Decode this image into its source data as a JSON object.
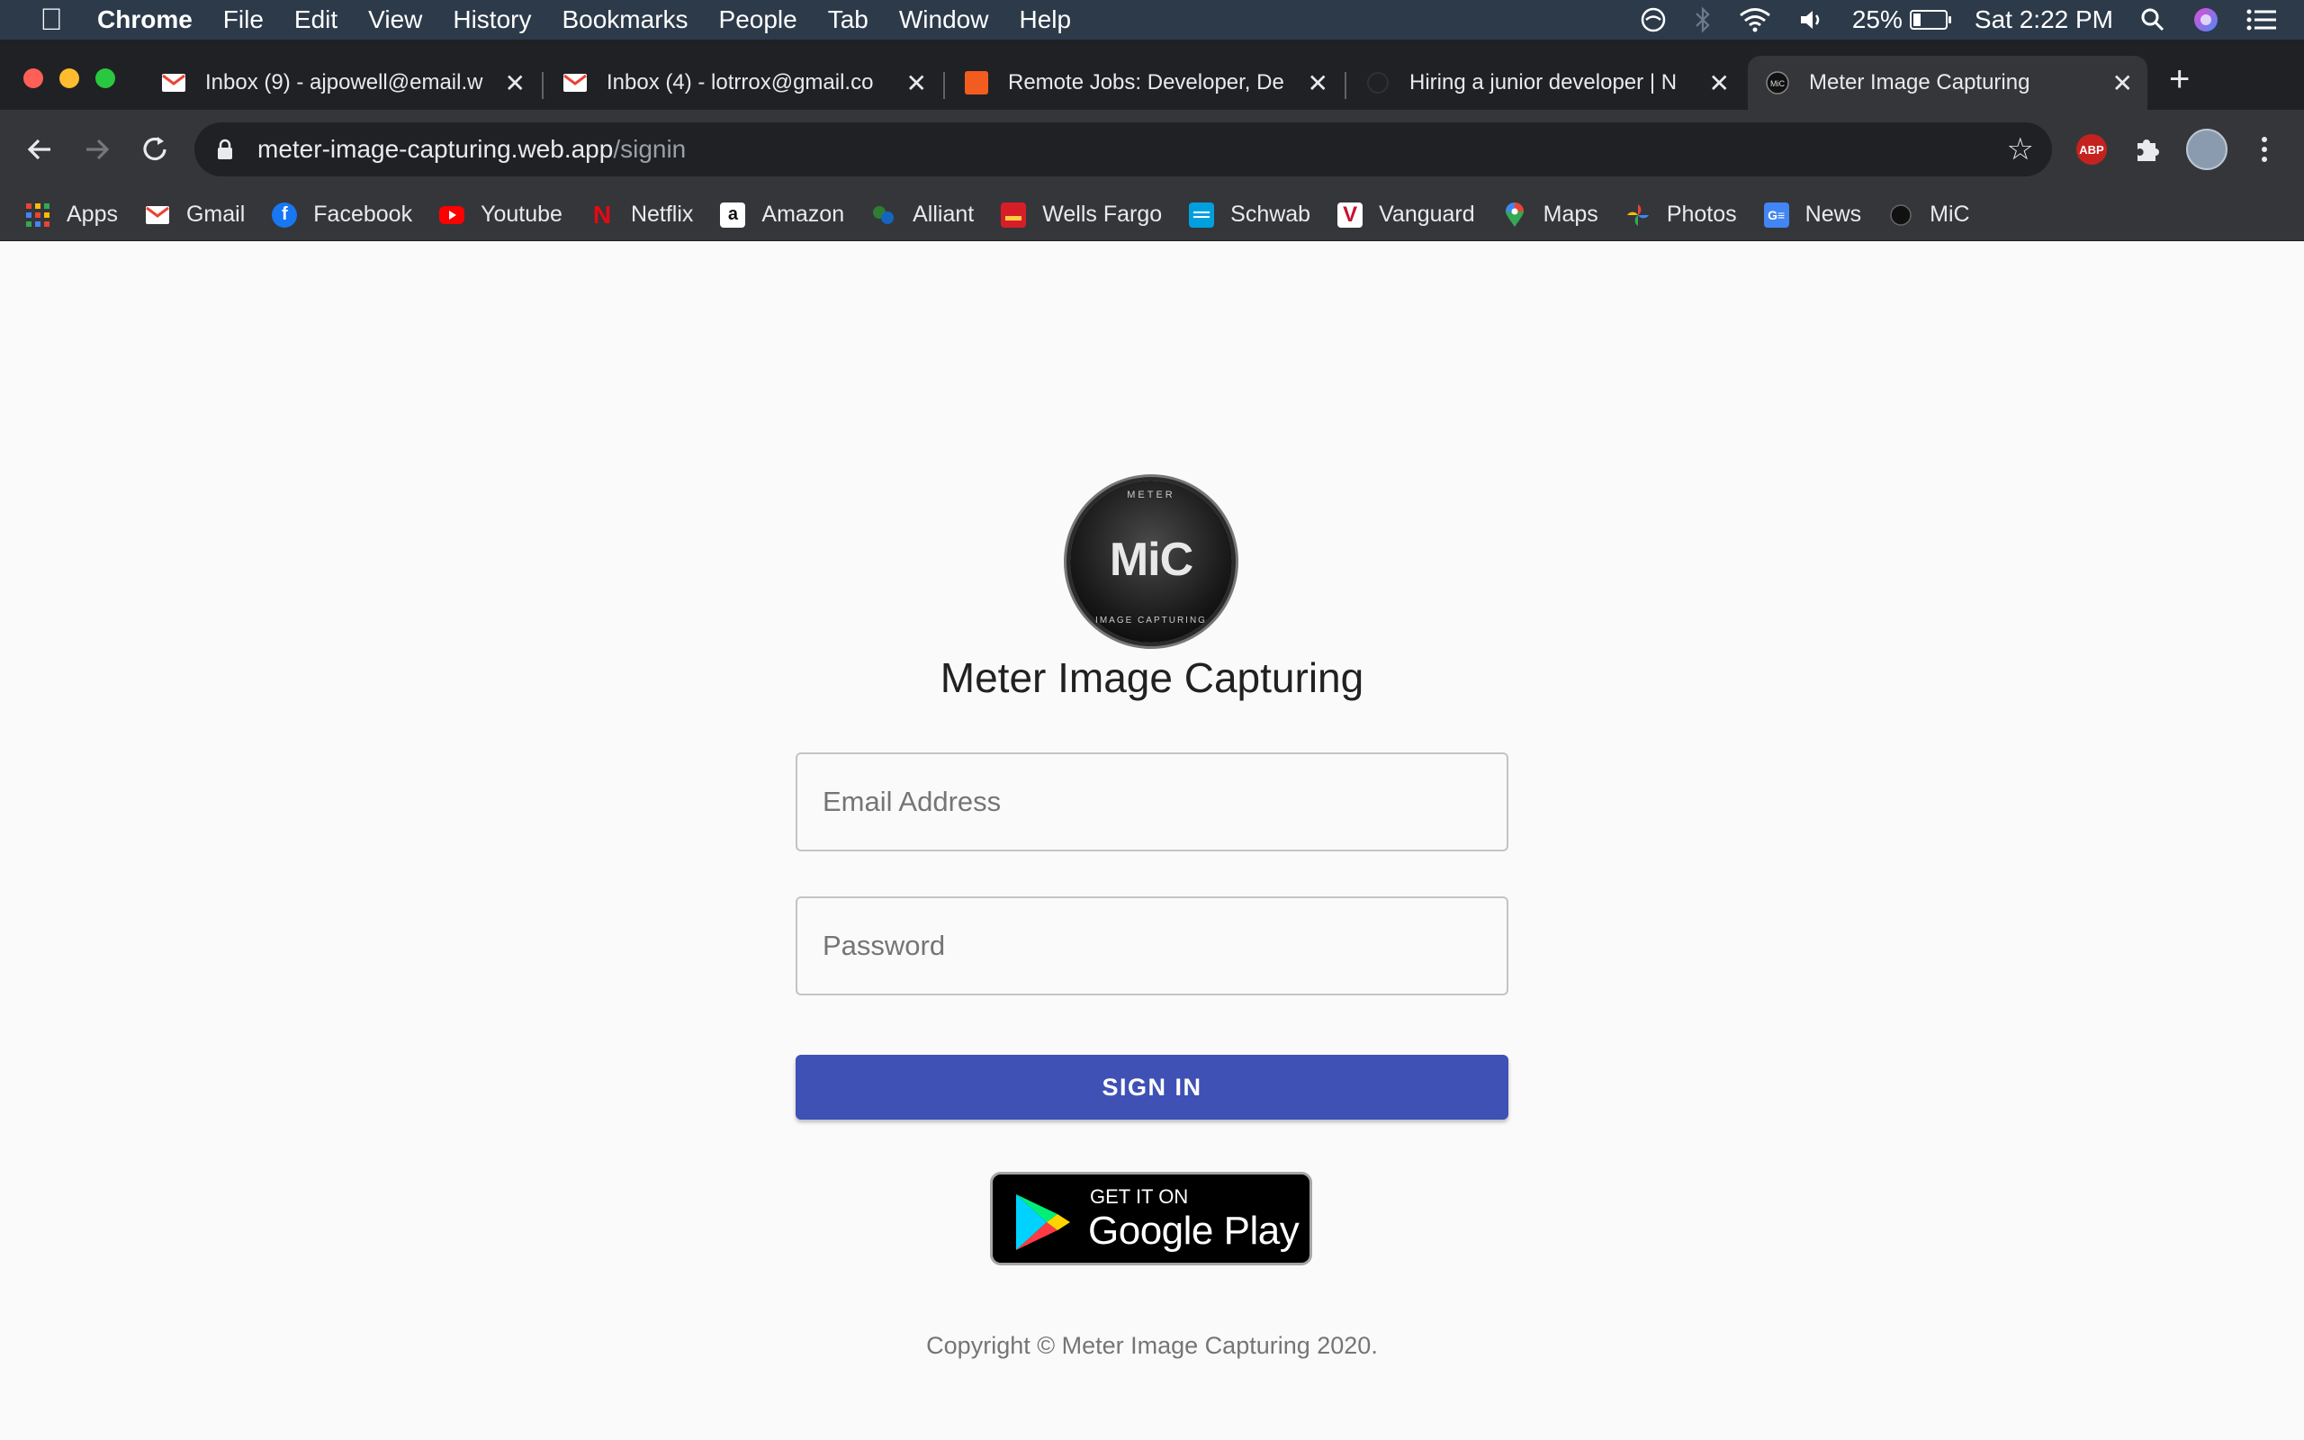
{
  "menubar": {
    "app_name": "Chrome",
    "items": [
      "File",
      "Edit",
      "View",
      "History",
      "Bookmarks",
      "People",
      "Tab",
      "Window",
      "Help"
    ],
    "battery": "25%",
    "clock": "Sat 2:22 PM"
  },
  "tabs": [
    {
      "title": "Inbox (9) - ajpowell@email.w",
      "icon": "gmail-icon"
    },
    {
      "title": "Inbox (4) - lotrrox@gmail.co",
      "icon": "gmail-icon"
    },
    {
      "title": "Remote Jobs: Developer, De",
      "icon": "remote-jobs-icon"
    },
    {
      "title": "Hiring a junior developer | N",
      "icon": "hiring-icon"
    },
    {
      "title": "Meter Image Capturing",
      "icon": "mic-icon",
      "active": true
    }
  ],
  "address_bar": {
    "host": "meter-image-capturing.web.app",
    "path": "/signin"
  },
  "bookmarks": [
    {
      "label": "Apps",
      "icon": "apps-grid-icon"
    },
    {
      "label": "Gmail",
      "icon": "gmail-icon"
    },
    {
      "label": "Facebook",
      "icon": "facebook-icon"
    },
    {
      "label": "Youtube",
      "icon": "youtube-icon"
    },
    {
      "label": "Netflix",
      "icon": "netflix-icon"
    },
    {
      "label": "Amazon",
      "icon": "amazon-icon"
    },
    {
      "label": "Alliant",
      "icon": "alliant-icon"
    },
    {
      "label": "Wells Fargo",
      "icon": "wells-fargo-icon"
    },
    {
      "label": "Schwab",
      "icon": "schwab-icon"
    },
    {
      "label": "Vanguard",
      "icon": "vanguard-icon"
    },
    {
      "label": "Maps",
      "icon": "maps-icon"
    },
    {
      "label": "Photos",
      "icon": "photos-icon"
    },
    {
      "label": "News",
      "icon": "news-icon"
    },
    {
      "label": "MiC",
      "icon": "mic-icon"
    }
  ],
  "extensions": {
    "adblock_label": "ABP"
  },
  "signin_page": {
    "logo_text": "MiC",
    "logo_ring_top": "METER",
    "logo_ring_bottom": "IMAGE CAPTURING",
    "title": "Meter Image Capturing",
    "email_placeholder": "Email Address",
    "password_placeholder": "Password",
    "signin_label": "SIGN IN",
    "store_badge_small": "GET IT ON",
    "store_badge_big": "Google Play",
    "copyright": "Copyright © Meter Image Capturing 2020."
  },
  "colors": {
    "primary_button": "#3f51b5",
    "page_background": "#fafafa",
    "browser_frame": "#35363a"
  }
}
